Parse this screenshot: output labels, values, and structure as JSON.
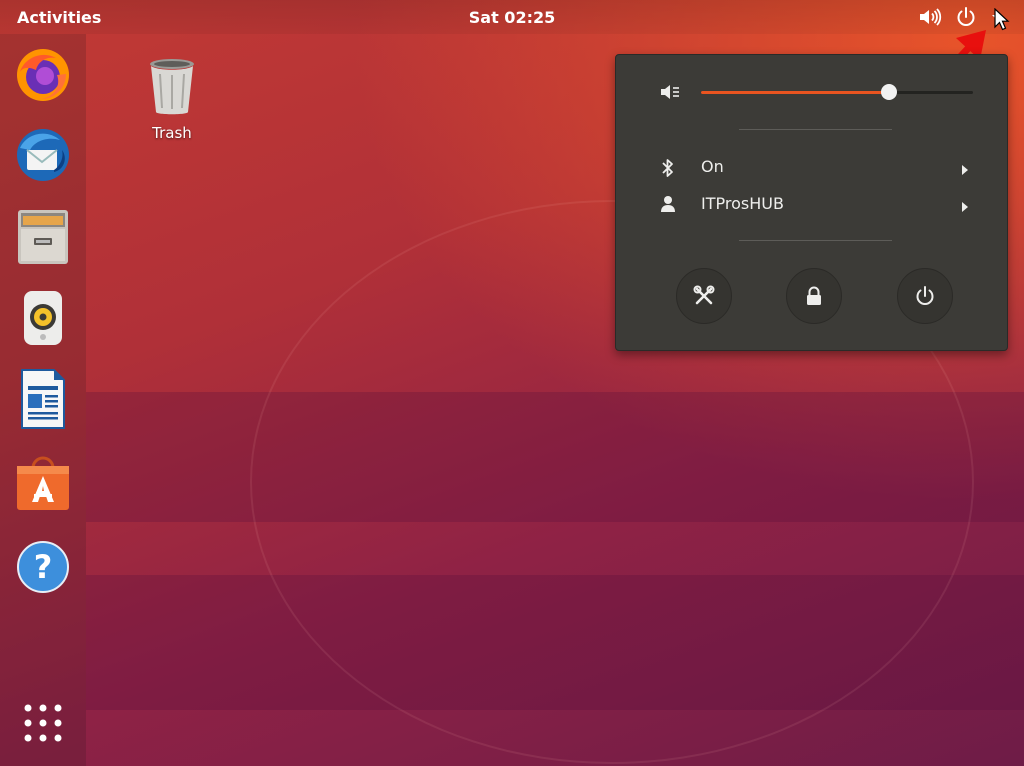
{
  "topbar": {
    "activities_label": "Activities",
    "clock": "Sat 02:25"
  },
  "desktop": {
    "trash_label": "Trash"
  },
  "dock": {
    "items": [
      "firefox-icon",
      "thunderbird-icon",
      "files-icon",
      "rhythmbox-icon",
      "libreoffice-writer-icon",
      "ubuntu-software-icon",
      "help-icon",
      "show-applications-icon"
    ]
  },
  "system_menu": {
    "volume_fraction": 0.69,
    "bluetooth_label": "On",
    "user_label": "ITProsHUB",
    "buttons": [
      "settings-icon",
      "lock-icon",
      "power-icon"
    ]
  },
  "colors": {
    "accent": "#e95420",
    "menu_bg": "#3c3b37",
    "annotation": "#e8100e"
  }
}
